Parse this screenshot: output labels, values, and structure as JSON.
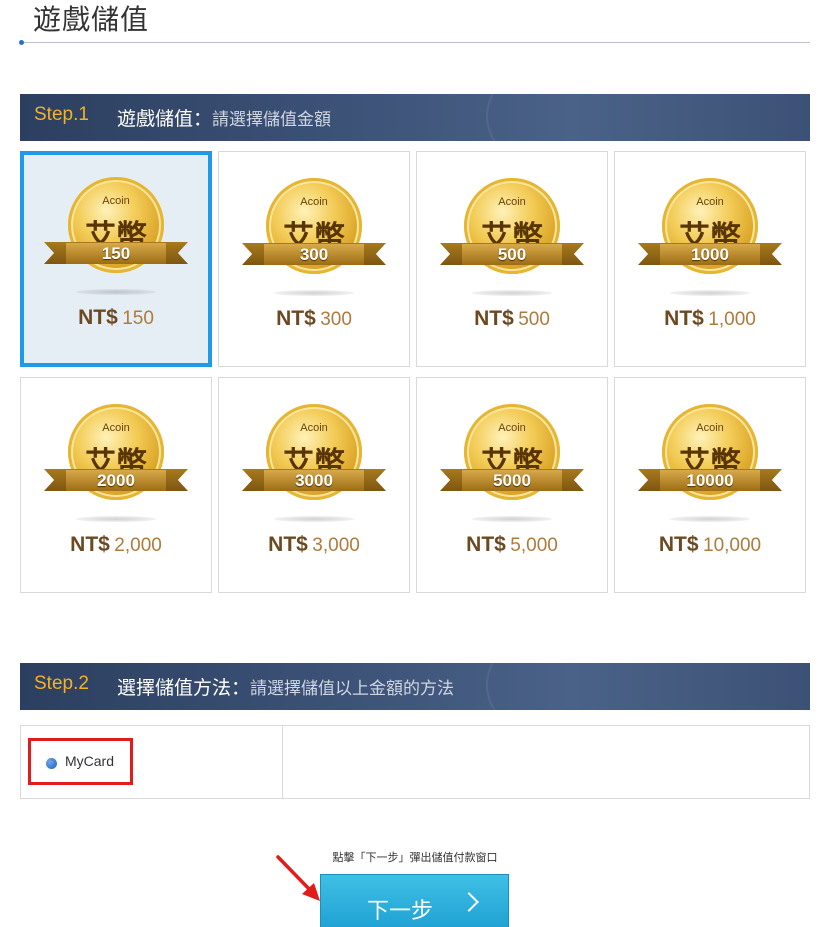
{
  "page": {
    "title": "遊戲儲值"
  },
  "step1": {
    "label": "Step.1",
    "name": "遊戲儲值：",
    "hint": "請選擇儲值金額"
  },
  "coins": [
    {
      "acoin": "Acoin",
      "name": "艾幣",
      "value": "150",
      "currency": "NT$",
      "amount": "150",
      "selected": true
    },
    {
      "acoin": "Acoin",
      "name": "艾幣",
      "value": "300",
      "currency": "NT$",
      "amount": "300",
      "selected": false
    },
    {
      "acoin": "Acoin",
      "name": "艾幣",
      "value": "500",
      "currency": "NT$",
      "amount": "500",
      "selected": false
    },
    {
      "acoin": "Acoin",
      "name": "艾幣",
      "value": "1000",
      "currency": "NT$",
      "amount": "1,000",
      "selected": false
    },
    {
      "acoin": "Acoin",
      "name": "艾幣",
      "value": "2000",
      "currency": "NT$",
      "amount": "2,000",
      "selected": false
    },
    {
      "acoin": "Acoin",
      "name": "艾幣",
      "value": "3000",
      "currency": "NT$",
      "amount": "3,000",
      "selected": false
    },
    {
      "acoin": "Acoin",
      "name": "艾幣",
      "value": "5000",
      "currency": "NT$",
      "amount": "5,000",
      "selected": false
    },
    {
      "acoin": "Acoin",
      "name": "艾幣",
      "value": "10000",
      "currency": "NT$",
      "amount": "10,000",
      "selected": false
    }
  ],
  "step2": {
    "label": "Step.2",
    "name": "選擇儲值方法：",
    "hint": "請選擇儲值以上金額的方法"
  },
  "payment_methods": [
    {
      "label": "MyCard",
      "selected": true
    }
  ],
  "footer": {
    "hint": "點擊「下一步」彈出儲值付款窗口",
    "next_label": "下一步"
  },
  "colors": {
    "accent": "#1e9ae6",
    "step_label": "#f4b223",
    "highlight_box": "#e21b1b",
    "button": "#2bb3e0"
  },
  "icons": {
    "radio": "radio-dot-icon",
    "next": "chevron-right-icon",
    "annotation": "red-arrow-icon"
  }
}
